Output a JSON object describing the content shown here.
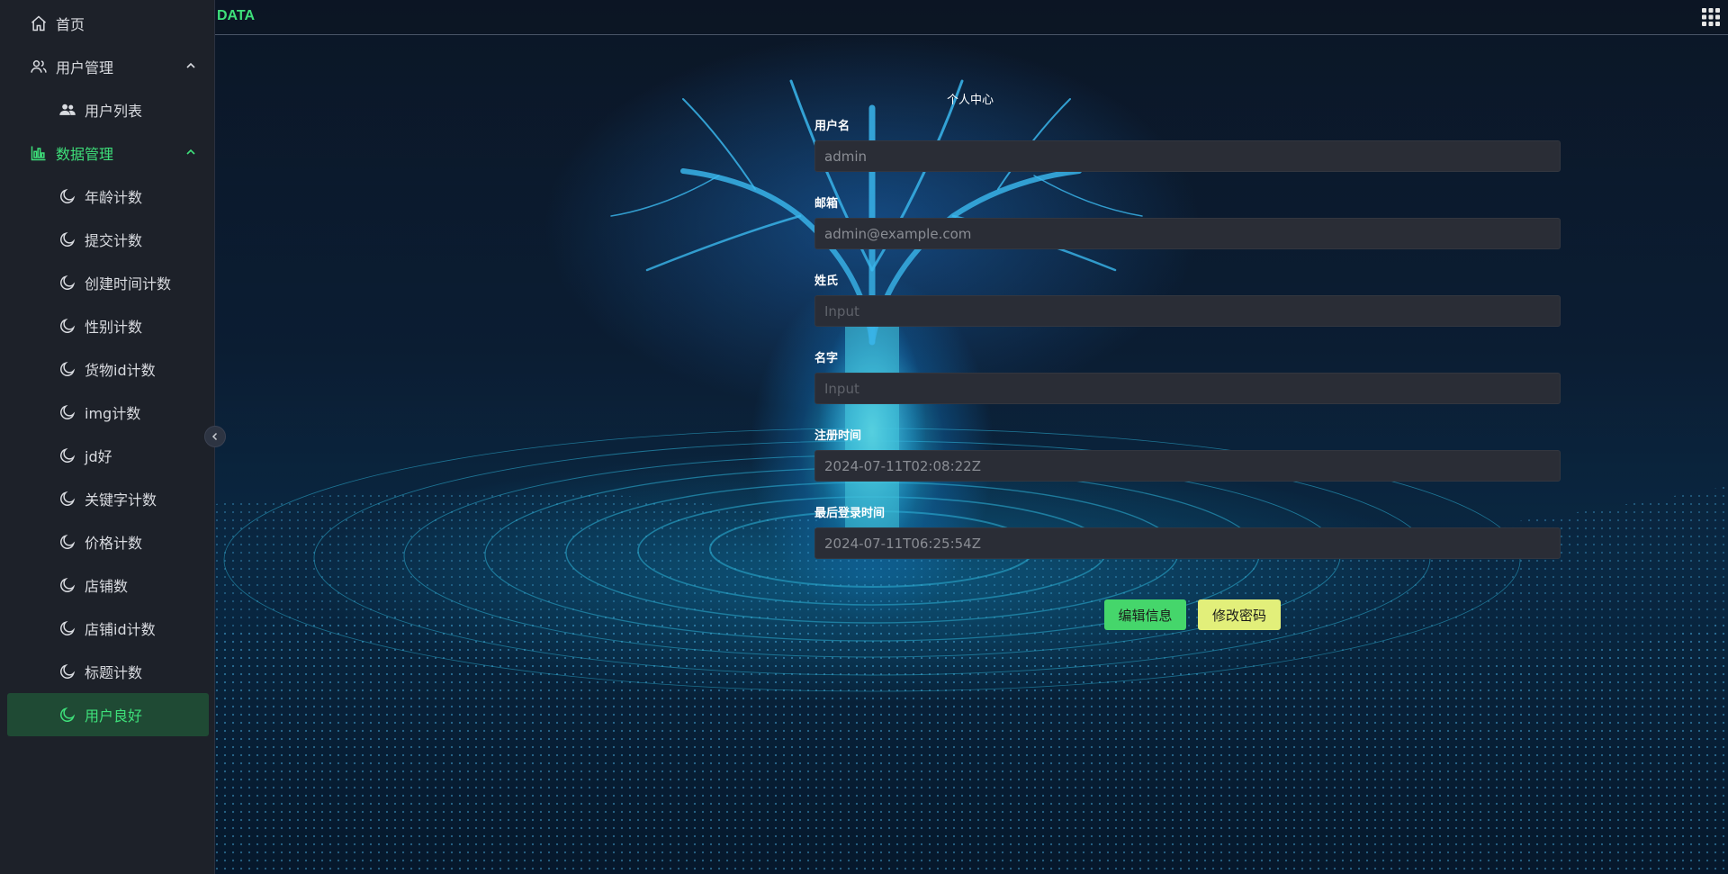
{
  "sidebar": {
    "items": [
      {
        "label": "首页",
        "icon": "home-icon"
      },
      {
        "label": "用户管理",
        "icon": "users-icon"
      },
      {
        "label": "用户列表",
        "icon": "user-group-icon"
      },
      {
        "label": "数据管理",
        "icon": "chart-icon"
      },
      {
        "label": "年龄计数",
        "icon": "moon-icon"
      },
      {
        "label": "提交计数",
        "icon": "moon-icon"
      },
      {
        "label": "创建时间计数",
        "icon": "moon-icon"
      },
      {
        "label": "性别计数",
        "icon": "moon-icon"
      },
      {
        "label": "货物id计数",
        "icon": "moon-icon"
      },
      {
        "label": "img计数",
        "icon": "moon-icon"
      },
      {
        "label": "jd好",
        "icon": "moon-icon"
      },
      {
        "label": "关键字计数",
        "icon": "moon-icon"
      },
      {
        "label": "价格计数",
        "icon": "moon-icon"
      },
      {
        "label": "店铺数",
        "icon": "moon-icon"
      },
      {
        "label": "店铺id计数",
        "icon": "moon-icon"
      },
      {
        "label": "标题计数",
        "icon": "moon-icon"
      },
      {
        "label": "用户良好",
        "icon": "moon-icon"
      }
    ]
  },
  "header": {
    "brand": "DATA"
  },
  "profile": {
    "title": "个人中心",
    "fields": [
      {
        "label": "用户名",
        "value": "admin",
        "placeholder": ""
      },
      {
        "label": "邮箱",
        "value": "admin@example.com",
        "placeholder": ""
      },
      {
        "label": "姓氏",
        "value": "",
        "placeholder": "Input"
      },
      {
        "label": "名字",
        "value": "",
        "placeholder": "Input"
      },
      {
        "label": "注册时间",
        "value": "2024-07-11T02:08:22Z",
        "placeholder": ""
      },
      {
        "label": "最后登录时间",
        "value": "2024-07-11T06:25:54Z",
        "placeholder": ""
      }
    ],
    "edit_label": "编辑信息",
    "password_label": "修改密码"
  },
  "colors": {
    "accent": "#3ee07a",
    "edit_button": "#45d66b",
    "password_button": "#e2ef7a",
    "sidebar_bg": "#1d2129"
  }
}
